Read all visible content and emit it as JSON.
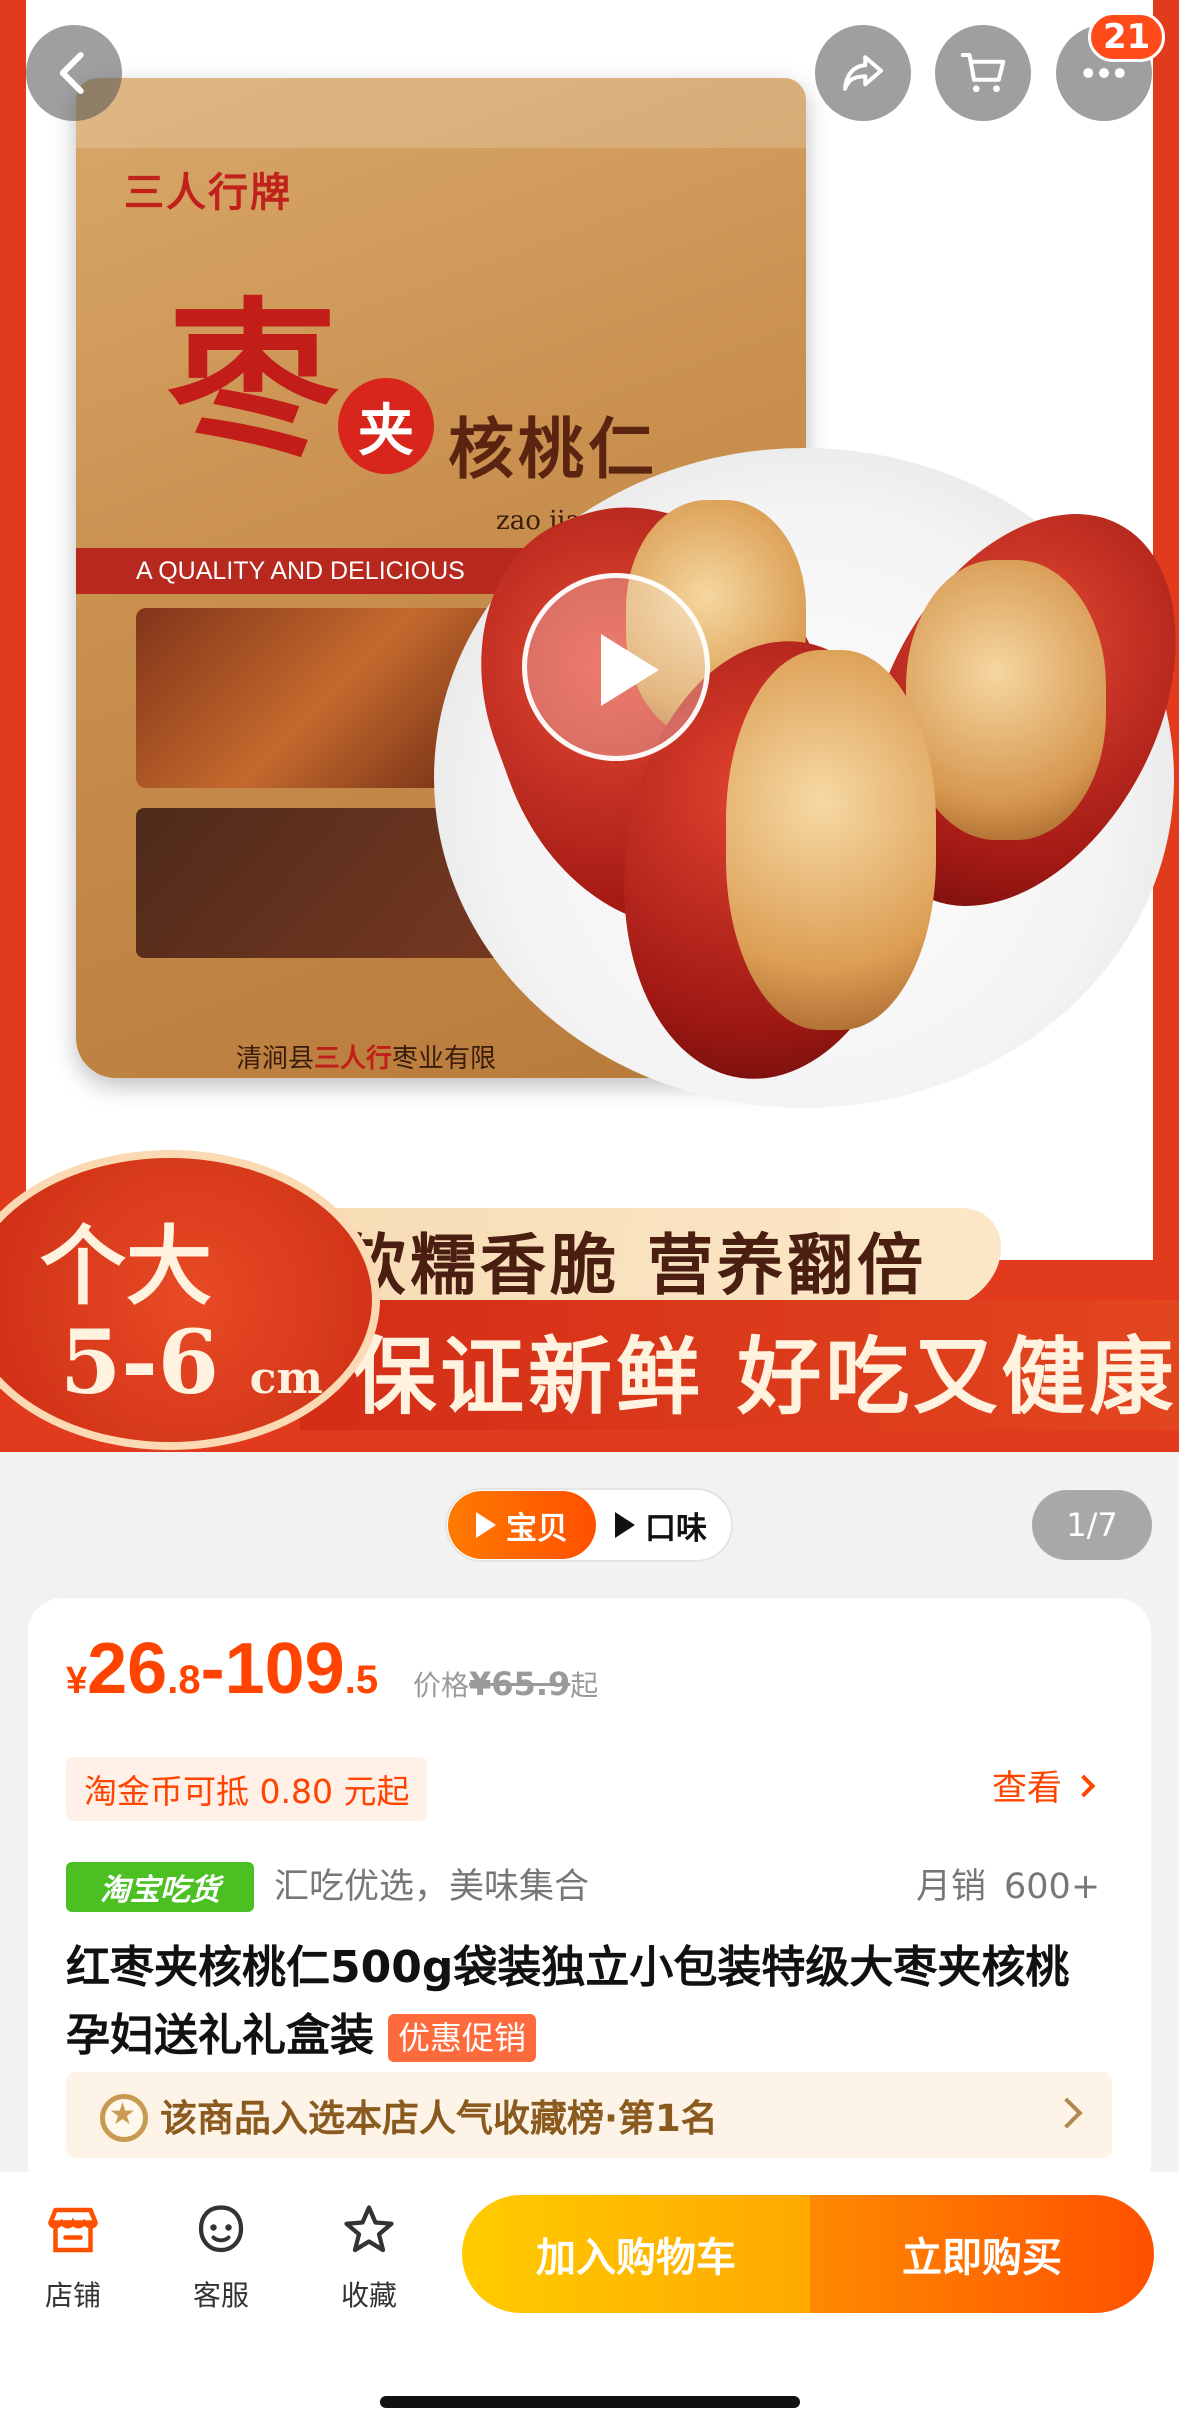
{
  "hero": {
    "bag_brand": "三人行牌",
    "bag_big_char": "枣",
    "bag_circle_char": "夹",
    "bag_name": "核桃仁",
    "bag_pinyin": "zao jia he tao ren",
    "bag_band": "A QUALITY AND DELICIOUS",
    "bag_maker": "清涧县",
    "bag_maker_brand": "三人行",
    "bag_maker_rest": "枣业有限",
    "size_label": "个大",
    "size_value": "5-6",
    "size_unit": "cm",
    "banner_line1": "软糯香脆  营养翻倍",
    "banner_line2": "保证新鲜  好吃又健康"
  },
  "top_bar": {
    "back_icon": "chevron-left-icon",
    "share_icon": "share-icon",
    "cart_icon": "cart-icon",
    "more_icon": "more-icon",
    "notification_count": "21"
  },
  "media_switch": {
    "active_label": "宝贝",
    "other_label": "口味",
    "page_indicator": "1/7"
  },
  "price": {
    "currency": "¥",
    "low_int": "26",
    "low_dec": ".8",
    "sep": "-",
    "high_int": "109",
    "high_dec": ".5",
    "orig_label": "价格",
    "orig_value": "¥65.9",
    "orig_suffix": "起"
  },
  "coin": {
    "text": "淘金币可抵 0.80 元起",
    "view_label": "查看"
  },
  "tags": {
    "badge": "淘宝吃货",
    "slogan": "汇吃优选，美味集合",
    "sales_label": "月销",
    "sales_value": "600+"
  },
  "product": {
    "title": "红枣夹核桃仁500g袋装独立小包装特级大枣夹核桃孕妇送礼礼盒装",
    "promo_tag": "优惠促销"
  },
  "ranking": {
    "text": "该商品入选本店人气收藏榜·第1名"
  },
  "bottom_nav": {
    "store": "店铺",
    "service": "客服",
    "favorite": "收藏",
    "add_cart": "加入购物车",
    "buy_now": "立即购买"
  },
  "colors": {
    "accent": "#ff5000",
    "price": "#ff4400",
    "cart_button": "#ffb400",
    "badge_green": "#4cbf23"
  }
}
